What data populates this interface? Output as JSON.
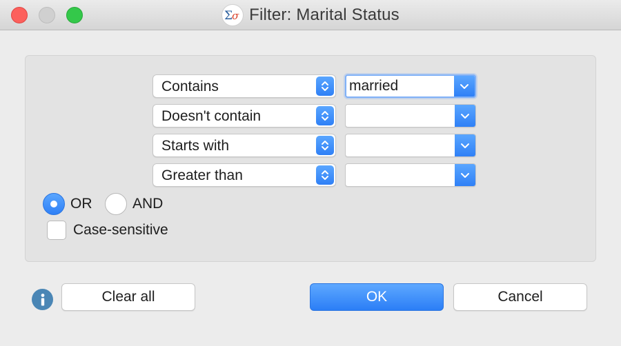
{
  "window": {
    "title": "Filter: Marital Status",
    "app_icon": "sigma-icon"
  },
  "rules": [
    {
      "operator": "Contains",
      "value": "married",
      "focused": true
    },
    {
      "operator": "Doesn't contain",
      "value": ""
    },
    {
      "operator": "Starts with",
      "value": ""
    },
    {
      "operator": "Greater than",
      "value": ""
    }
  ],
  "logic": {
    "or_label": "OR",
    "and_label": "AND",
    "selected": "OR"
  },
  "case_sensitive": {
    "label": "Case-sensitive",
    "checked": false
  },
  "buttons": {
    "clear_all": "Clear all",
    "ok": "OK",
    "cancel": "Cancel"
  },
  "colors": {
    "accent": "#2f80f6",
    "close": "#fc605c",
    "maximize": "#34c84a",
    "info": "#4a86b5"
  }
}
